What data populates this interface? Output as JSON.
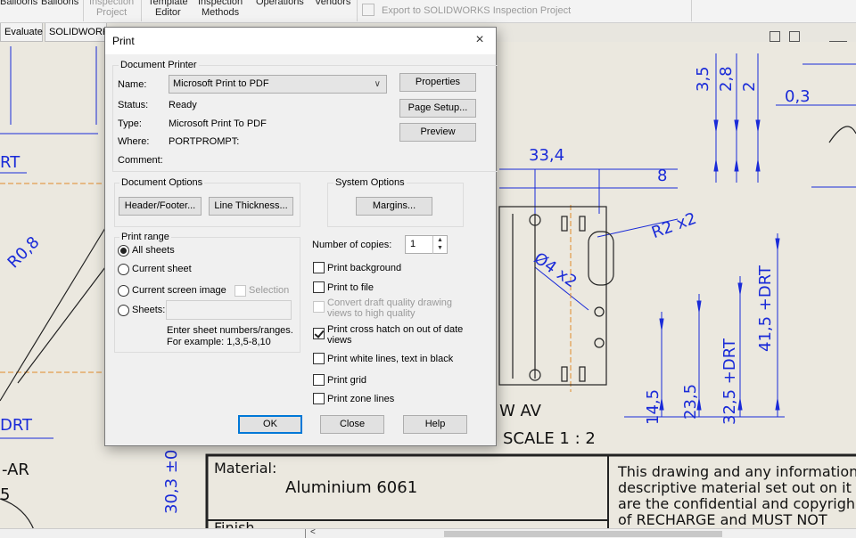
{
  "ribbon": {
    "items": [
      {
        "label": "Balloons",
        "label2": "",
        "disabled": false
      },
      {
        "label": "Balloons",
        "label2": "",
        "disabled": false
      },
      {
        "label": "Inspection",
        "label2": "Project",
        "disabled": true
      },
      {
        "label": "Template",
        "label2": "Editor",
        "disabled": false
      },
      {
        "label": "Inspection",
        "label2": "Methods",
        "disabled": false
      },
      {
        "label": "Operations",
        "label2": "",
        "disabled": false
      },
      {
        "label": "Vendors",
        "label2": "",
        "disabled": false
      }
    ],
    "export_label": "Export to SOLIDWORKS Inspection Project"
  },
  "tabs": [
    "Evaluate",
    "SOLIDWORKS"
  ],
  "drawing": {
    "dims": [
      "3,5",
      "2,8",
      "2",
      "0,3",
      "33,4",
      "8",
      "R2 x2",
      "Ø4 x2",
      "R0,8",
      "RT",
      "DRT",
      "DRT",
      "14,5",
      "23,5",
      "32,5 +DRT",
      "41,5 +DRT",
      "30,3 ±0"
    ],
    "view_label": "W AV",
    "scale_label": "SCALE 1 : 2",
    "left_text": "-AR",
    "left_text2": "5",
    "material_label": "Material:",
    "material_value": "Aluminium 6061",
    "notice_lines": [
      "This drawing and any information",
      "descriptive material set out on it",
      "are the confidential and copyrigh",
      "of RECHARGE and MUST NOT"
    ],
    "bottom_label": "Finish"
  },
  "dialog": {
    "title": "Print",
    "document_printer": {
      "heading": "Document Printer",
      "name_label": "Name:",
      "name_value": "Microsoft Print to PDF",
      "status_label": "Status:",
      "status_value": "Ready",
      "type_label": "Type:",
      "type_value": "Microsoft Print To PDF",
      "where_label": "Where:",
      "where_value": "PORTPROMPT:",
      "comment_label": "Comment:",
      "comment_value": "",
      "properties_btn": "Properties",
      "page_setup_btn": "Page Setup...",
      "preview_btn": "Preview"
    },
    "document_options": {
      "heading": "Document Options",
      "header_footer_btn": "Header/Footer...",
      "line_thickness_btn": "Line Thickness..."
    },
    "system_options": {
      "heading": "System Options",
      "margins_btn": "Margins..."
    },
    "print_range": {
      "heading": "Print range",
      "all_sheets": "All sheets",
      "current_sheet": "Current sheet",
      "current_screen_image": "Current screen image",
      "selection": "Selection",
      "sheets": "Sheets:",
      "hint_line1": "Enter sheet numbers/ranges.",
      "hint_line2": "For example: 1,3,5-8,10",
      "selected": "All sheets"
    },
    "copies_label": "Number of copies:",
    "copies_value": "1",
    "options": [
      {
        "label": "Print background",
        "checked": false,
        "disabled": false
      },
      {
        "label": "Print to file",
        "checked": false,
        "disabled": false
      },
      {
        "label": "Convert draft quality drawing",
        "label2": "views to high quality",
        "checked": false,
        "disabled": true
      },
      {
        "label": "Print cross hatch on out of date",
        "label2": "views",
        "checked": true,
        "disabled": false
      },
      {
        "label": "Print white lines, text in black",
        "checked": false,
        "disabled": false
      },
      {
        "label": "Print grid",
        "checked": false,
        "disabled": false
      },
      {
        "label": "Print zone lines",
        "checked": false,
        "disabled": false
      }
    ],
    "ok_btn": "OK",
    "close_btn": "Close",
    "help_btn": "Help",
    "close_icon": "×"
  },
  "colors": {
    "dimension_blue": "#1a2bd8",
    "sheet_bg": "#ebe8df",
    "dialog_bg": "#f0f0f0",
    "default_button_border": "#0078d7"
  }
}
